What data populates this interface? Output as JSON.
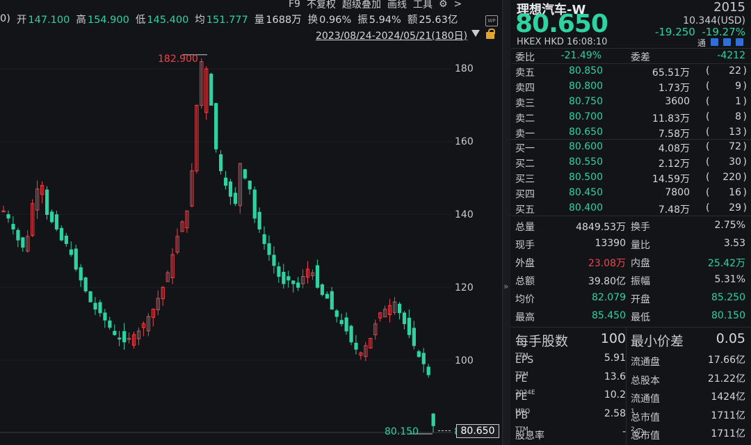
{
  "toolbar": {
    "f9": "F9",
    "adjust": "不复权",
    "overlay": "超级叠加",
    "draw": "画线",
    "tools": "工具",
    "chevron": ">"
  },
  "info": {
    "paren": "0)",
    "open_label": "开",
    "open": "147.100",
    "high_label": "高",
    "high": "154.900",
    "low_label": "低",
    "low": "145.400",
    "avg_label": "均",
    "avg": "151.777",
    "vol_label": "量",
    "vol": "1688万",
    "turn_label": "换",
    "turn": "0.96%",
    "amp_label": "振",
    "amp": "5.94%",
    "amt_label": "额",
    "amt": "25.63亿",
    "wm_icon": "WP"
  },
  "chart": {
    "date_range": "2023/08/24-2024/05/21(180日)",
    "high_marker": "182.900",
    "low_marker": "80.150",
    "last_price": "80.650",
    "y_ticks": [
      "180",
      "160",
      "140",
      "120",
      "100"
    ],
    "y_clip": "8"
  },
  "chart_data": {
    "type": "candlestick",
    "ylim": [
      78,
      195
    ],
    "y_ticks": [
      100,
      120,
      140,
      160,
      180
    ],
    "high": 182.9,
    "low": 80.15,
    "last": 80.65,
    "closes": [
      141,
      139,
      136,
      133,
      131,
      134,
      143,
      147,
      148,
      140,
      138,
      136,
      133,
      132,
      129,
      125,
      122,
      119,
      116,
      114,
      113,
      111,
      109,
      107,
      106,
      105,
      106,
      107,
      108,
      110,
      112,
      114,
      117,
      120,
      124,
      129,
      134,
      138,
      141,
      152,
      170,
      182,
      180,
      170,
      158,
      152,
      148,
      145,
      143,
      154,
      150,
      147,
      139,
      136,
      132,
      129,
      126,
      123,
      121,
      122,
      121,
      120,
      123,
      125,
      124,
      120,
      118,
      117,
      114,
      112,
      110,
      108,
      105,
      103,
      102,
      104,
      106,
      110,
      113,
      114,
      115,
      116,
      113,
      110,
      107,
      104,
      101,
      99,
      96,
      82
    ]
  },
  "right": {
    "name": "理想汽车-W",
    "code": "2015",
    "price": "80.650",
    "usd": "10.344(USD)",
    "change": "-19.250",
    "change_pct": "-19.27%",
    "market": "HKEX  HKD 16:08:10",
    "tong": "通",
    "weibi_label": "委比",
    "weibi": "-21.49%",
    "weicha_label": "委差",
    "weicha": "-4212",
    "asks": [
      {
        "label": "卖五",
        "price": "80.850",
        "vol": "65.51万",
        "cnt": "22"
      },
      {
        "label": "卖四",
        "price": "80.800",
        "vol": "1.73万",
        "cnt": "9"
      },
      {
        "label": "卖三",
        "price": "80.750",
        "vol": "3600",
        "cnt": "1"
      },
      {
        "label": "卖二",
        "price": "80.700",
        "vol": "11.83万",
        "cnt": "8"
      },
      {
        "label": "卖一",
        "price": "80.650",
        "vol": "7.58万",
        "cnt": "13"
      }
    ],
    "bids": [
      {
        "label": "买一",
        "price": "80.600",
        "vol": "4.08万",
        "cnt": "72"
      },
      {
        "label": "买二",
        "price": "80.550",
        "vol": "2.12万",
        "cnt": "30"
      },
      {
        "label": "买三",
        "price": "80.500",
        "vol": "14.59万",
        "cnt": "220"
      },
      {
        "label": "买四",
        "price": "80.450",
        "vol": "7800",
        "cnt": "16"
      },
      {
        "label": "买五",
        "price": "80.400",
        "vol": "7.48万",
        "cnt": "29"
      }
    ],
    "stats": [
      {
        "l1": "总量",
        "v1": "4849.53万",
        "c1": "w",
        "l2": "换手",
        "v2": "2.75%",
        "c2": "w"
      },
      {
        "l1": "现手",
        "v1": "13390",
        "c1": "w",
        "l2": "量比",
        "v2": "3.53",
        "c2": "w"
      },
      {
        "l1": "外盘",
        "v1": "23.08万",
        "c1": "r",
        "l2": "内盘",
        "v2": "25.42万",
        "c2": "g"
      },
      {
        "l1": "总额",
        "v1": "39.80亿",
        "c1": "w",
        "l2": "振幅",
        "v2": "5.31%",
        "c2": "w"
      },
      {
        "l1": "均价",
        "v1": "82.079",
        "c1": "g",
        "l2": "开盘",
        "v2": "85.250",
        "c2": "g"
      },
      {
        "l1": "最高",
        "v1": "85.450",
        "c1": "g",
        "l2": "最低",
        "v2": "80.150",
        "c2": "g"
      }
    ],
    "lot_label": "每手股数",
    "lot": "100",
    "tick_label": "最小价差",
    "tick": "0.05",
    "fund": [
      {
        "l1": "EPS",
        "s1": "TTM",
        "v1": "5.91",
        "l2": "流通盘",
        "s2": "",
        "v2": "17.66亿"
      },
      {
        "l1": "PE",
        "s1": "TTM",
        "v1": "13.6",
        "l2": "总股本",
        "s2": "",
        "v2": "21.22亿"
      },
      {
        "l1": "PE",
        "s1": "2024E",
        "v1": "10.2",
        "l2": "流通值",
        "s2": "",
        "v2": "1424亿"
      },
      {
        "l1": "PB",
        "s1": "MRQ",
        "v1": "2.58",
        "l2": "总市值",
        "s2": "1",
        "v2": "1711亿"
      },
      {
        "l1": "股息率",
        "s1": "TTM",
        "v1": "-",
        "l2": "总市值",
        "s2": "2",
        "v2": "1711亿"
      }
    ],
    "info_glyph": "i"
  },
  "divider": "»",
  "colors": {
    "up": "#f0444c",
    "down": "#2fd3a2",
    "bg": "#131418"
  }
}
